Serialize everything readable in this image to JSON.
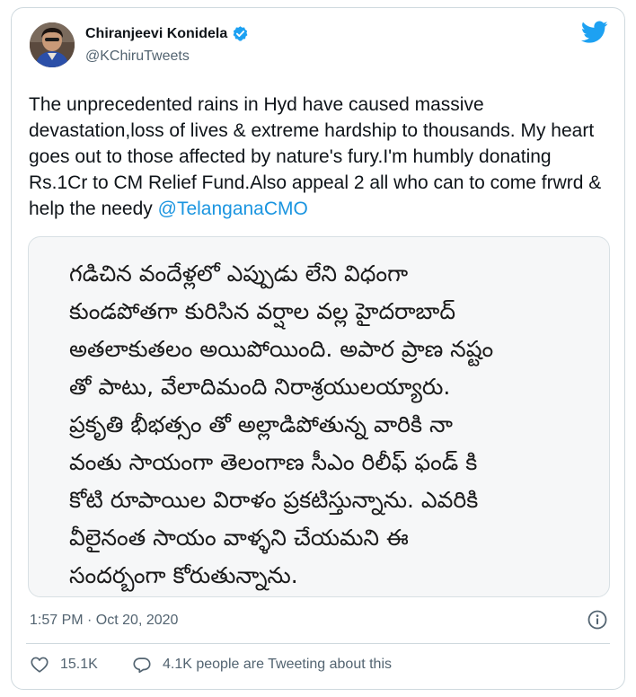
{
  "author": {
    "display_name": "Chiranjeevi Konidela",
    "handle": "@KChiruTweets",
    "verified": true,
    "avatar_icon": "profile-photo"
  },
  "brand": {
    "logo_icon": "twitter-bird-icon",
    "color": "#1da1f2"
  },
  "tweet": {
    "text": "The unprecedented rains in Hyd have caused massive devastation,loss of lives & extreme hardship to thousands. My heart goes out to those affected by nature's fury.I'm humbly donating Rs.1Cr to CM Relief Fund.Also appeal 2 all who can to come frwrd & help the needy ",
    "mention": "@TelanganaCMO",
    "mention_color": "#1b95e0",
    "timestamp": "1:57 PM · Oct 20, 2020"
  },
  "media": {
    "lines": [
      "గడిచిన వందేళ్లలో ఎప్పుడు లేని విధంగా",
      "కుండపోతగా కురిసిన వర్షాల వల్ల హైదరాబాద్",
      "అతలాకుతలం అయిపోయింది. అపార ప్రాణ నష్టం",
      "తో పాటు, వేలాదిమంది నిరాశ్రయులయ్యారు.",
      "ప్రకృతి భీభత్సం తో అల్లాడిపోతున్న వారికి నా",
      "వంతు సాయంగా తెలంగాణ సీఎం రిలీఫ్ ఫండ్ కి",
      "కోటి రూపాయిల విరాళం ప్రకటిస్తున్నాను. ఎవరికి",
      "వీలైనంత సాయం వాళ్ళని చేయమని ఈ",
      "సందర్బంగా కోరుతున్నాను."
    ]
  },
  "actions": {
    "like_icon": "heart-icon",
    "like_count": "15.1K",
    "reply_icon": "speech-bubble-icon",
    "reply_text": "4.1K people are Tweeting about this",
    "info_icon": "info-icon"
  }
}
